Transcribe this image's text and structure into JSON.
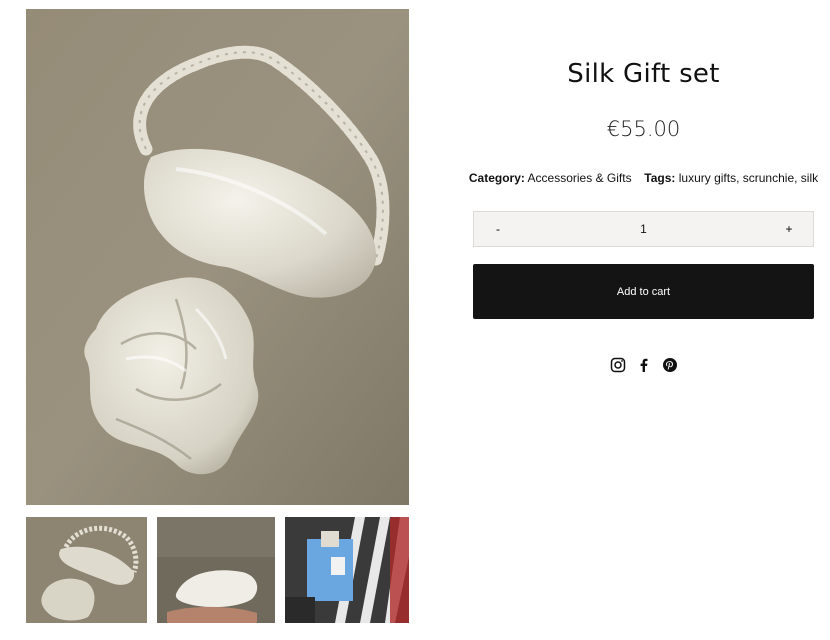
{
  "product": {
    "title": "Silk Gift set",
    "price": "€55.00",
    "category_label": "Category:",
    "category_value": "Accessories & Gifts",
    "tags_label": "Tags:",
    "tags_value": "luxury gifts, scrunchie, silk"
  },
  "quantity": {
    "decrement_label": "-",
    "value": "1",
    "increment_label": "+"
  },
  "cart": {
    "add_label": "Add to cart"
  },
  "social": {
    "icons": [
      "instagram-icon",
      "facebook-icon",
      "pinterest-icon"
    ]
  },
  "colors": {
    "button_bg": "#141414",
    "qty_bg": "#f4f3f1",
    "image_bg": "#8f8775",
    "silk": "#e9e6dc"
  },
  "gallery": {
    "thumbnail_count": 3
  }
}
